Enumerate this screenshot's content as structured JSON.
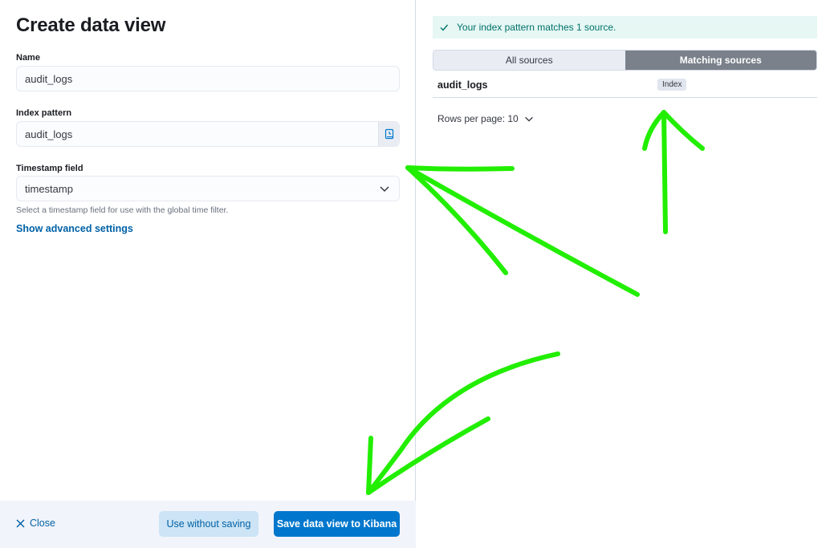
{
  "form": {
    "title": "Create data view",
    "name_label": "Name",
    "name_value": "audit_logs",
    "index_pattern_label": "Index pattern",
    "index_pattern_value": "audit_logs",
    "timestamp_label": "Timestamp field",
    "timestamp_value": "timestamp",
    "timestamp_help": "Select a timestamp field for use with the global time filter.",
    "advanced_link": "Show advanced settings"
  },
  "footer": {
    "close_label": "Close",
    "use_without_saving_label": "Use without saving",
    "save_label": "Save data view to Kibana"
  },
  "sources": {
    "callout": "Your index pattern matches 1 source.",
    "tabs": [
      {
        "label": "All sources",
        "active": false
      },
      {
        "label": "Matching sources",
        "active": true
      }
    ],
    "rows": [
      {
        "name": "audit_logs",
        "type": "Index"
      }
    ],
    "rows_per_page": "Rows per page: 10"
  },
  "colors": {
    "primary": "#0077cc",
    "success_text": "#00726b",
    "annotation": "#22ee00"
  }
}
